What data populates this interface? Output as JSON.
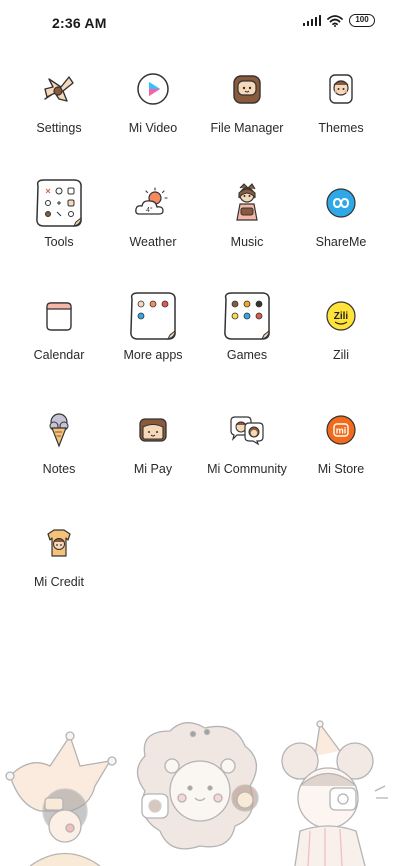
{
  "status_bar": {
    "time": "2:36 AM",
    "battery": "100",
    "icons": [
      "signal-icon",
      "wifi-icon",
      "battery-icon"
    ]
  },
  "apps": [
    {
      "label": "Settings",
      "icon": "settings-icon"
    },
    {
      "label": "Mi Video",
      "icon": "play-icon"
    },
    {
      "label": "File Manager",
      "icon": "folder-icon"
    },
    {
      "label": "Themes",
      "icon": "themes-icon"
    },
    {
      "label": "Tools",
      "icon": "tools-folder-icon"
    },
    {
      "label": "Weather",
      "icon": "weather-icon"
    },
    {
      "label": "Music",
      "icon": "music-icon"
    },
    {
      "label": "ShareMe",
      "icon": "shareme-icon"
    },
    {
      "label": "Calendar",
      "icon": "calendar-icon"
    },
    {
      "label": "More apps",
      "icon": "more-apps-folder-icon"
    },
    {
      "label": "Games",
      "icon": "games-folder-icon"
    },
    {
      "label": "Zili",
      "icon": "zili-icon"
    },
    {
      "label": "Notes",
      "icon": "ice-cream-icon"
    },
    {
      "label": "Mi Pay",
      "icon": "wallet-icon"
    },
    {
      "label": "Mi Community",
      "icon": "community-icon"
    },
    {
      "label": "Mi Store",
      "icon": "mi-logo-icon"
    },
    {
      "label": "Mi Credit",
      "icon": "credit-icon"
    }
  ],
  "icon_text": {
    "weather_temp": "4°",
    "zili_logo": "Zili",
    "mi_logo": "mi"
  },
  "colors": {
    "shareme": "#2ea8e6",
    "mistore": "#f26b1d",
    "zili": "#ffe23a",
    "video_play": "#6a5cff",
    "doodle_skin": "#f5d9b8",
    "doodle_brown": "#8a5a3c"
  }
}
